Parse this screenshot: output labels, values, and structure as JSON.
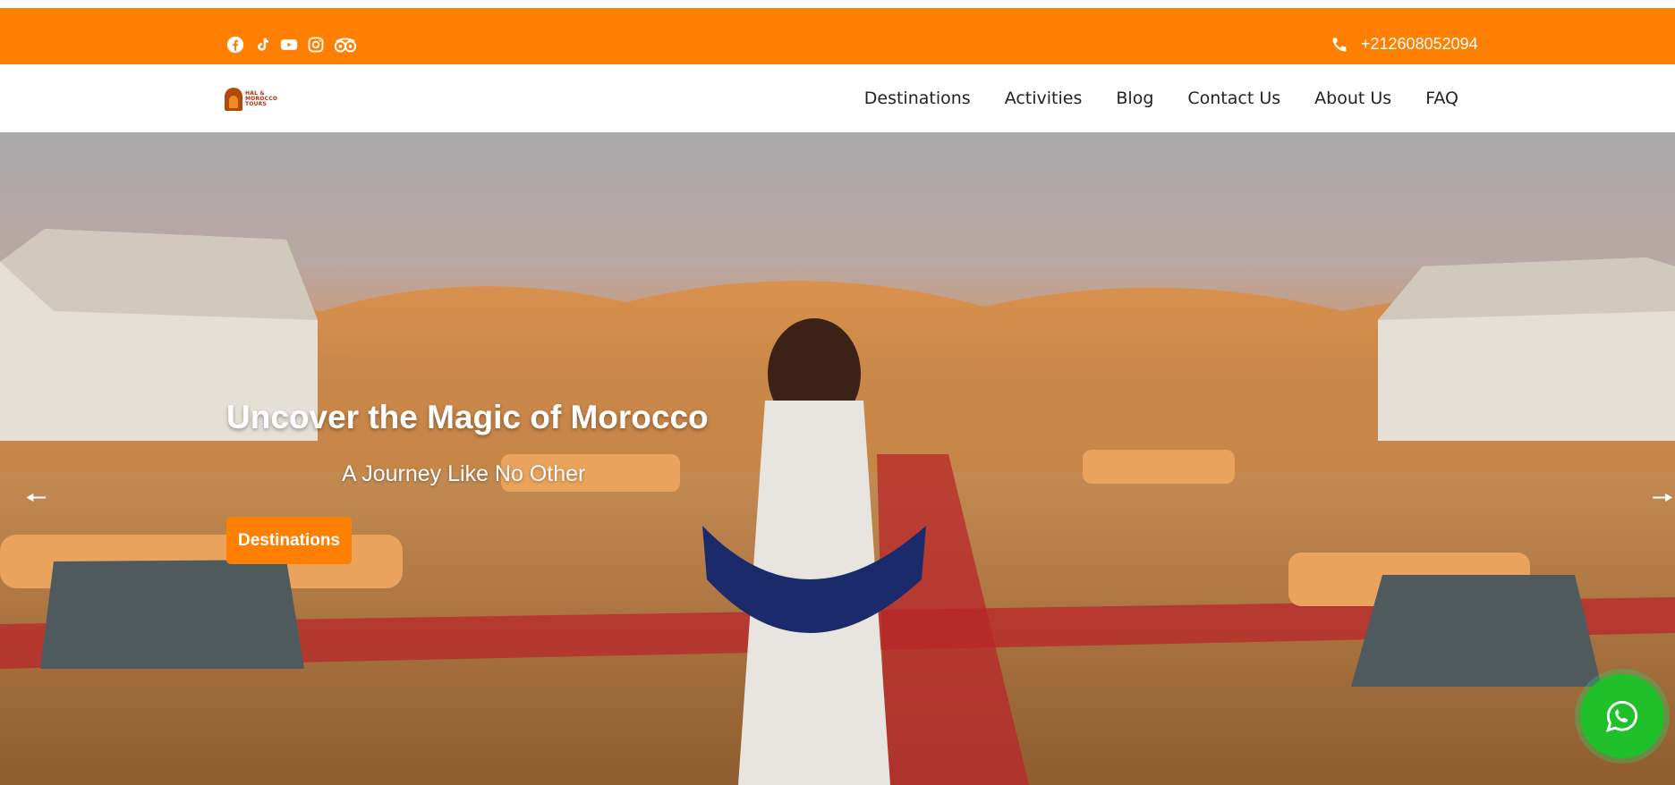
{
  "colors": {
    "accent": "#ff8000",
    "whatsapp": "#20c02a",
    "nav_text": "#222222"
  },
  "topbar": {
    "social_icons": [
      "facebook-icon",
      "tiktok-icon",
      "youtube-icon",
      "instagram-icon",
      "tripadvisor-icon"
    ],
    "phone": "+212608052094"
  },
  "navbar": {
    "logo_lines": [
      "HAL &",
      "MOROCCO",
      "TOURS"
    ],
    "menu": [
      "Destinations",
      "Activities",
      "Blog",
      "Contact Us",
      "About Us",
      "FAQ"
    ]
  },
  "hero": {
    "title": "Uncover the Magic of Morocco",
    "subtitle": "A Journey Like No Other",
    "button_label": "Destinations",
    "prev_arrow": "🠔",
    "next_arrow": "🠖"
  },
  "floating": {
    "icon": "whatsapp-icon"
  }
}
